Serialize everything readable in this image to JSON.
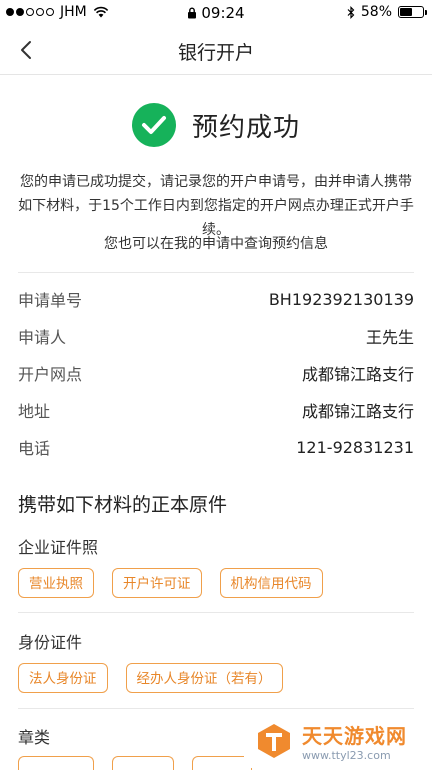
{
  "status_bar": {
    "carrier": "JHM",
    "time": "09:24",
    "battery": "58%",
    "battery_level": 0.58,
    "signal_bars_filled": 2,
    "signal_bars_total": 5
  },
  "nav": {
    "title": "银行开户",
    "back_icon": "chevron-left-icon"
  },
  "success": {
    "icon": "check-circle-icon",
    "icon_color": "#16b25a",
    "title": "预约成功",
    "description": "您的申请已成功提交，请记录您的开户申请号，由并申请人携带如下材料，于15个工作日内到您指定的开户网点办理正式开户手续。",
    "sub_description": "您也可以在我的申请中查询预约信息"
  },
  "info": [
    {
      "label": "申请单号",
      "value": "BH192392130139"
    },
    {
      "label": "申请人",
      "value": "王先生"
    },
    {
      "label": "开户网点",
      "value": "成都锦江路支行"
    },
    {
      "label": "地址",
      "value": "成都锦江路支行"
    },
    {
      "label": "电话",
      "value": "121-92831231"
    }
  ],
  "materials": {
    "title": "携带如下材料的正本原件",
    "tag_color": "#e8872a",
    "categories": [
      {
        "name": "企业证件照",
        "tags": [
          "营业执照",
          "开户许可证",
          "机构信用代码"
        ]
      },
      {
        "name": "身份证件",
        "tags": [
          "法人身份证",
          "经办人身份证（若有）"
        ]
      },
      {
        "name": "章类",
        "tags": [
          "",
          "",
          ""
        ]
      }
    ]
  },
  "watermark": {
    "title": "天天游戏网",
    "url": "www.ttyl23.com"
  }
}
